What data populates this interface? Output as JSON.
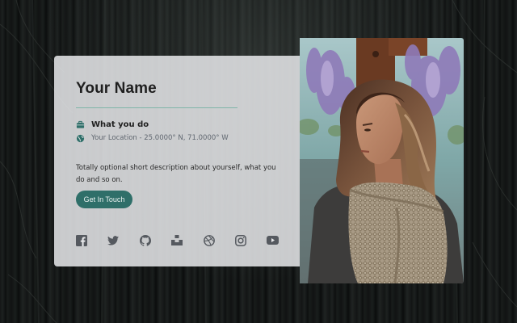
{
  "profile": {
    "name": "Your Name",
    "job": "What you do",
    "location": "Your Location - 25.0000° N, 71.0000° W",
    "description": "Totally optional short description about yourself, what you do and so on.",
    "cta_label": "Get In Touch"
  },
  "icons": {
    "job": "briefcase-icon",
    "location": "globe-icon"
  },
  "socials": [
    {
      "name": "facebook-icon"
    },
    {
      "name": "twitter-icon"
    },
    {
      "name": "github-icon"
    },
    {
      "name": "unsplash-icon"
    },
    {
      "name": "dribbble-icon"
    },
    {
      "name": "instagram-icon"
    },
    {
      "name": "youtube-icon"
    }
  ],
  "colors": {
    "accent": "#2f6f69",
    "divider": "#7fb5a8",
    "icon": "#2f6f69",
    "social_icon": "#55595f",
    "card_bg": "#e8e9eb"
  },
  "photo": {
    "description_icon": "portrait-photo"
  }
}
